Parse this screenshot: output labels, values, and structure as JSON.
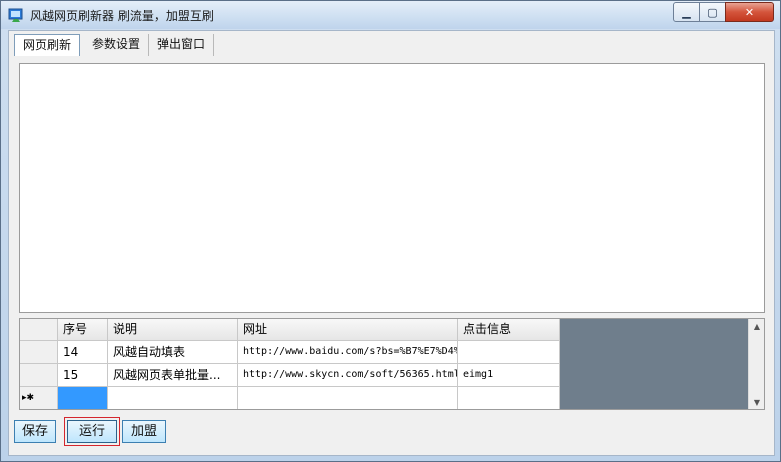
{
  "window": {
    "title": "风越网页刷新器 刷流量，加盟互刷",
    "icon": "app-monitor-icon",
    "controls": {
      "minimize": "minimize-icon",
      "maximize": "maximize-icon",
      "close": "close-icon"
    }
  },
  "tabs": [
    {
      "label": "网页刷新",
      "active": true
    },
    {
      "label": "参数设置",
      "active": false
    },
    {
      "label": "弹出窗口",
      "active": false
    }
  ],
  "grid": {
    "columns": [
      "序号",
      "说明",
      "网址",
      "点击信息"
    ],
    "rows": [
      {
        "seq": "14",
        "desc": "风越自动填表",
        "url": "http://www.baidu.com/s?bs=%B7%E7%D4%",
        "click": ""
      },
      {
        "seq": "15",
        "desc": "风越网页表单批量...",
        "url": "http://www.skycn.com/soft/56365.html",
        "click": "eimg1"
      }
    ],
    "new_row_marker": "▸✱"
  },
  "buttons": {
    "save": "保存",
    "run": "运行",
    "join": "加盟"
  },
  "colors": {
    "accent": "#3399ff",
    "highlight_box": "#d4262e",
    "grid_empty_area": "#6f7e8c"
  }
}
